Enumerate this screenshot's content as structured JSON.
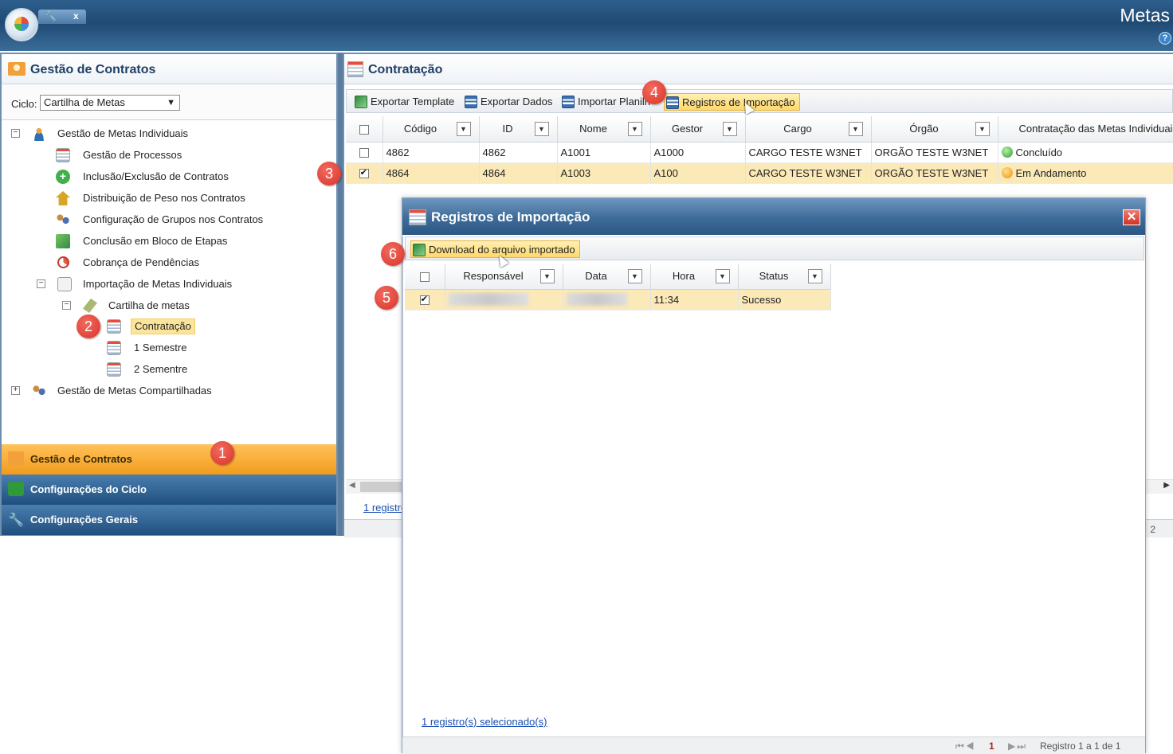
{
  "topbar": {
    "app_title": "Metas",
    "tool_icon": "wrench-icon",
    "close_label": "x",
    "help_label": "?"
  },
  "left": {
    "header_title": "Gestão de Contratos",
    "ciclo_label": "Ciclo:",
    "ciclo_value": "Cartilha de Metas",
    "tree": {
      "gestao_individuais": "Gestão de Metas Individuais",
      "gestao_processos": "Gestão de Processos",
      "inclusao": "Inclusão/Exclusão de Contratos",
      "distribuicao": "Distribuição de Peso nos Contratos",
      "configuracao_grupos": "Configuração de Grupos nos Contratos",
      "conclusao_bloco": "Conclusão em Bloco de Etapas",
      "cobranca": "Cobrança de Pendências",
      "importacao": "Importação de Metas Individuais",
      "cartilha": "Cartilha de metas",
      "contratacao": "Contratação",
      "semestre1": "1 Semestre",
      "semestre2": "2 Sementre",
      "gestao_compartilhadas": "Gestão de Metas Compartilhadas"
    },
    "accordion": {
      "gestao": "Gestão de Contratos",
      "config_ciclo": "Configurações do Ciclo",
      "config_gerais": "Configurações Gerais"
    }
  },
  "main": {
    "header_title": "Contratação",
    "toolbar": {
      "exportar_template": "Exportar Template",
      "exportar_dados": "Exportar Dados",
      "importar_planilha": "Importar Planilh",
      "registros_importacao": "Registros de Importação"
    },
    "columns": [
      "Código",
      "ID",
      "Nome",
      "Gestor",
      "Cargo",
      "Órgão",
      "Contratação das Metas Individuai"
    ],
    "rows": [
      {
        "codigo": "4862",
        "id": "4862",
        "nome": "A1001",
        "gestor": "A1000",
        "cargo": "CARGO TESTE W3NET",
        "orgao": "ORGÃO TESTE W3NET",
        "status": "Concluído",
        "status_color": "#2f9a3a",
        "checked": false
      },
      {
        "codigo": "4864",
        "id": "4864",
        "nome": "A1003",
        "gestor": "A100",
        "cargo": "CARGO TESTE W3NET",
        "orgao": "ORGÃO TESTE W3NET",
        "status": "Em Andamento",
        "status_color": "#ef8e12",
        "checked": true
      }
    ],
    "footer_link": "1 registro",
    "page_fragment": "2"
  },
  "modal": {
    "title": "Registros de Importação",
    "close_label": "✕",
    "download_label": "Download do arquivo importado",
    "columns": [
      "Responsável",
      "Data",
      "Hora",
      "Status"
    ],
    "row": {
      "hora": "11:34",
      "status": "Sucesso"
    },
    "selected_link": "1 registro(s) selecionado(s)",
    "page_current": "1",
    "page_info": "Registro 1 a 1 de 1"
  },
  "badges": [
    "1",
    "2",
    "3",
    "4",
    "5",
    "6"
  ],
  "colors": {
    "accent_orange": "#f29b1d",
    "header_blue": "#1f4a73",
    "selected_row": "#fbe9b7",
    "badge_red": "#d9322a"
  }
}
